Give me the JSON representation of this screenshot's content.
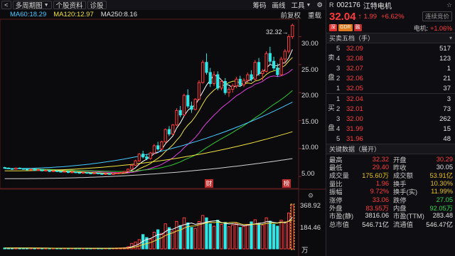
{
  "toolbar": {
    "back_label": "<",
    "period_label": "多周期图",
    "stock_info_label": "个股资料",
    "diagnose_label": "诊股",
    "chips_label": "筹码",
    "draw_label": "画线",
    "tools_label": "工具",
    "settings_icon": "gear-icon"
  },
  "ma_line": {
    "ma60": "MA60:18.29",
    "ma120": "MA120:12.97",
    "ma250": "MA250:8.16",
    "ma60_color": "#46c8ff",
    "ma120_color": "#f0e040",
    "ma250_color": "#e0e0e0"
  },
  "chart_tools": {
    "pre_adjust": "前复权",
    "overlay": "重载"
  },
  "price_axis": [
    "30.00",
    "25.00",
    "20.00",
    "15.00",
    "10.00",
    "5.00"
  ],
  "high_annotation": "32.32→",
  "event_markers": [
    "财",
    "榜"
  ],
  "volume_axis": [
    "368.92",
    "184.46",
    "万"
  ],
  "chart_data": {
    "type": "candlestick",
    "ylim": [
      4,
      33
    ],
    "candles": [
      [
        6.6,
        6.7,
        6.4,
        6.5
      ],
      [
        6.5,
        6.6,
        6.3,
        6.4
      ],
      [
        6.4,
        6.5,
        6.2,
        6.3
      ],
      [
        6.3,
        6.6,
        6.2,
        6.5
      ],
      [
        6.5,
        6.6,
        6.3,
        6.4
      ],
      [
        6.4,
        6.5,
        6.2,
        6.3
      ],
      [
        6.3,
        6.4,
        6.1,
        6.2
      ],
      [
        6.2,
        6.4,
        6.1,
        6.3
      ],
      [
        6.3,
        6.4,
        6.0,
        6.1
      ],
      [
        6.1,
        6.3,
        6.0,
        6.2
      ],
      [
        6.2,
        6.3,
        5.9,
        6.0
      ],
      [
        6.0,
        6.2,
        5.9,
        6.1
      ],
      [
        6.1,
        6.2,
        5.8,
        5.9
      ],
      [
        5.9,
        6.1,
        5.8,
        6.0
      ],
      [
        6.0,
        6.1,
        5.8,
        5.9
      ],
      [
        5.9,
        6.0,
        5.7,
        5.8
      ],
      [
        5.8,
        6.0,
        5.7,
        5.9
      ],
      [
        5.9,
        6.0,
        5.6,
        5.7
      ],
      [
        5.7,
        5.9,
        5.6,
        5.8
      ],
      [
        5.8,
        5.9,
        5.6,
        5.7
      ],
      [
        5.7,
        5.8,
        5.5,
        5.6
      ],
      [
        5.6,
        5.8,
        5.5,
        5.7
      ],
      [
        5.7,
        5.8,
        5.5,
        5.6
      ],
      [
        5.6,
        5.7,
        5.4,
        5.5
      ],
      [
        5.5,
        5.7,
        5.4,
        5.6
      ],
      [
        5.6,
        5.7,
        5.4,
        5.5
      ],
      [
        5.5,
        5.6,
        5.3,
        5.4
      ],
      [
        5.4,
        5.6,
        5.3,
        5.5
      ],
      [
        5.5,
        5.6,
        5.3,
        5.4
      ],
      [
        5.4,
        5.6,
        5.3,
        5.5
      ],
      [
        5.5,
        5.7,
        5.4,
        5.6
      ],
      [
        5.6,
        5.8,
        5.5,
        5.7
      ],
      [
        5.7,
        6.0,
        5.6,
        5.9
      ],
      [
        5.9,
        6.4,
        5.8,
        6.3
      ],
      [
        6.3,
        7.2,
        6.2,
        7.0
      ],
      [
        7.0,
        8.0,
        6.9,
        7.8
      ],
      [
        7.8,
        9.2,
        7.6,
        9.0
      ],
      [
        9.0,
        9.6,
        8.2,
        8.5
      ],
      [
        8.5,
        9.0,
        7.9,
        8.2
      ],
      [
        8.2,
        9.4,
        8.0,
        9.2
      ],
      [
        9.2,
        10.8,
        9.0,
        10.5
      ],
      [
        10.5,
        11.2,
        9.6,
        9.9
      ],
      [
        9.9,
        11.4,
        9.7,
        11.2
      ],
      [
        11.2,
        13.6,
        11.0,
        13.4
      ],
      [
        13.4,
        14.0,
        12.2,
        12.6
      ],
      [
        12.6,
        14.4,
        12.4,
        14.2
      ],
      [
        14.2,
        17.2,
        14.0,
        16.8
      ],
      [
        16.8,
        17.6,
        15.6,
        16.0
      ],
      [
        16.0,
        19.8,
        15.8,
        19.5
      ],
      [
        19.5,
        20.6,
        17.2,
        17.6
      ],
      [
        17.6,
        18.4,
        16.4,
        17.0
      ],
      [
        17.0,
        19.0,
        16.8,
        18.8
      ],
      [
        18.8,
        22.2,
        18.6,
        21.8
      ],
      [
        21.8,
        25.8,
        21.6,
        25.4
      ],
      [
        25.4,
        27.0,
        23.2,
        23.6
      ],
      [
        23.6,
        24.4,
        21.0,
        21.6
      ],
      [
        21.6,
        23.8,
        21.2,
        23.2
      ],
      [
        23.2,
        23.8,
        20.4,
        20.8
      ],
      [
        20.8,
        22.4,
        20.4,
        22.0
      ],
      [
        22.0,
        22.6,
        19.6,
        20.0
      ],
      [
        20.0,
        21.0,
        19.2,
        20.6
      ],
      [
        20.6,
        21.6,
        20.0,
        21.2
      ],
      [
        21.2,
        22.8,
        20.8,
        22.4
      ],
      [
        22.4,
        23.0,
        21.0,
        21.4
      ],
      [
        21.4,
        22.6,
        21.0,
        22.2
      ],
      [
        22.2,
        23.6,
        21.8,
        23.2
      ],
      [
        23.2,
        24.0,
        22.0,
        22.4
      ],
      [
        22.4,
        25.8,
        22.2,
        25.4
      ],
      [
        25.4,
        26.2,
        23.0,
        23.4
      ],
      [
        23.4,
        24.2,
        22.2,
        23.8
      ],
      [
        23.8,
        27.4,
        23.6,
        27.0
      ],
      [
        27.0,
        28.2,
        25.0,
        25.6
      ],
      [
        25.6,
        26.4,
        24.0,
        24.4
      ],
      [
        24.4,
        25.2,
        22.8,
        23.2
      ],
      [
        23.2,
        26.4,
        23.0,
        26.0
      ],
      [
        26.0,
        27.8,
        25.2,
        27.4
      ],
      [
        27.4,
        30.4,
        27.0,
        30.0
      ],
      [
        30.0,
        32.32,
        29.6,
        32.04
      ]
    ],
    "volume": [
      8,
      7,
      7,
      9,
      7,
      6,
      6,
      7,
      6,
      7,
      6,
      6,
      5,
      6,
      5,
      5,
      6,
      5,
      5,
      6,
      5,
      5,
      5,
      4,
      5,
      5,
      4,
      5,
      5,
      6,
      7,
      8,
      10,
      18,
      46,
      58,
      78,
      120,
      95,
      82,
      140,
      160,
      130,
      210,
      178,
      150,
      230,
      195,
      260,
      218,
      180,
      172,
      230,
      280,
      260,
      210,
      190,
      240,
      205,
      222,
      186,
      200,
      214,
      180,
      190,
      205,
      226,
      244,
      210,
      198,
      260,
      232,
      205,
      190,
      240,
      226,
      300,
      368
    ]
  },
  "quote": {
    "r_badge": "R",
    "code": "002176",
    "name": "江特电机",
    "star_icon": "star-icon",
    "price": "32.04",
    "change": "1.99",
    "pct": "+6.62%",
    "continuous": "连续竞价",
    "tags": [
      "深",
      "GDR",
      "融"
    ],
    "tag_colors": [
      "#e03030",
      "#e07a20",
      "#c02c2c"
    ],
    "sector_label": "电机:",
    "sector_pct": "+1.06%"
  },
  "orderbook": {
    "title": "买卖五档（手）",
    "sell_label": [
      "卖",
      "盘"
    ],
    "buy_label": [
      "买",
      "盘"
    ],
    "sells": [
      {
        "lv": "5",
        "price": "32.09",
        "vol": "517"
      },
      {
        "lv": "4",
        "price": "32.08",
        "vol": "123"
      },
      {
        "lv": "3",
        "price": "32.07",
        "vol": "1"
      },
      {
        "lv": "2",
        "price": "32.06",
        "vol": "21"
      },
      {
        "lv": "1",
        "price": "32.05",
        "vol": "37"
      }
    ],
    "buys": [
      {
        "lv": "1",
        "price": "32.04",
        "vol": "3"
      },
      {
        "lv": "2",
        "price": "32.01",
        "vol": "73"
      },
      {
        "lv": "3",
        "price": "32.00",
        "vol": "262"
      },
      {
        "lv": "4",
        "price": "31.99",
        "vol": "15"
      },
      {
        "lv": "5",
        "price": "31.96",
        "vol": "48"
      }
    ]
  },
  "stats_title": "关键数据（展开）",
  "stats": [
    {
      "k": "最高",
      "v": "32.32",
      "vc": "red",
      "k2": "开盘",
      "v2": "30.29",
      "v2c": "red"
    },
    {
      "k": "最低",
      "v": "29.40",
      "vc": "red",
      "k2": "昨收",
      "v2": "30.05",
      "v2c": "wht"
    },
    {
      "k": "成交量",
      "v": "175.60万",
      "vc": "yel",
      "k2": "成交额",
      "v2": "53.91亿",
      "v2c": "yel"
    },
    {
      "k": "量比",
      "v": "1.96",
      "vc": "red",
      "k2": "换手",
      "v2": "10.30%",
      "v2c": "yel"
    },
    {
      "k": "振幅",
      "v": "9.72%",
      "vc": "red",
      "k2": "换手(实)",
      "v2": "11.99%",
      "v2c": "yel"
    },
    {
      "k": "涨停",
      "v": "33.06",
      "vc": "red",
      "k2": "跌停",
      "v2": "27.05",
      "v2c": "grn"
    },
    {
      "k": "外盘",
      "v": "83.55万",
      "vc": "red",
      "k2": "内盘",
      "v2": "92.05万",
      "v2c": "grn"
    },
    {
      "k": "市盈(静)",
      "v": "3816.06",
      "vc": "wht",
      "k2": "市盈(TTM)",
      "v2": "283.48",
      "v2c": "wht"
    },
    {
      "k": "总市值",
      "v": "546.71亿",
      "vc": "wht",
      "k2": "流通值",
      "v2": "546.47亿",
      "v2c": "wht"
    }
  ]
}
